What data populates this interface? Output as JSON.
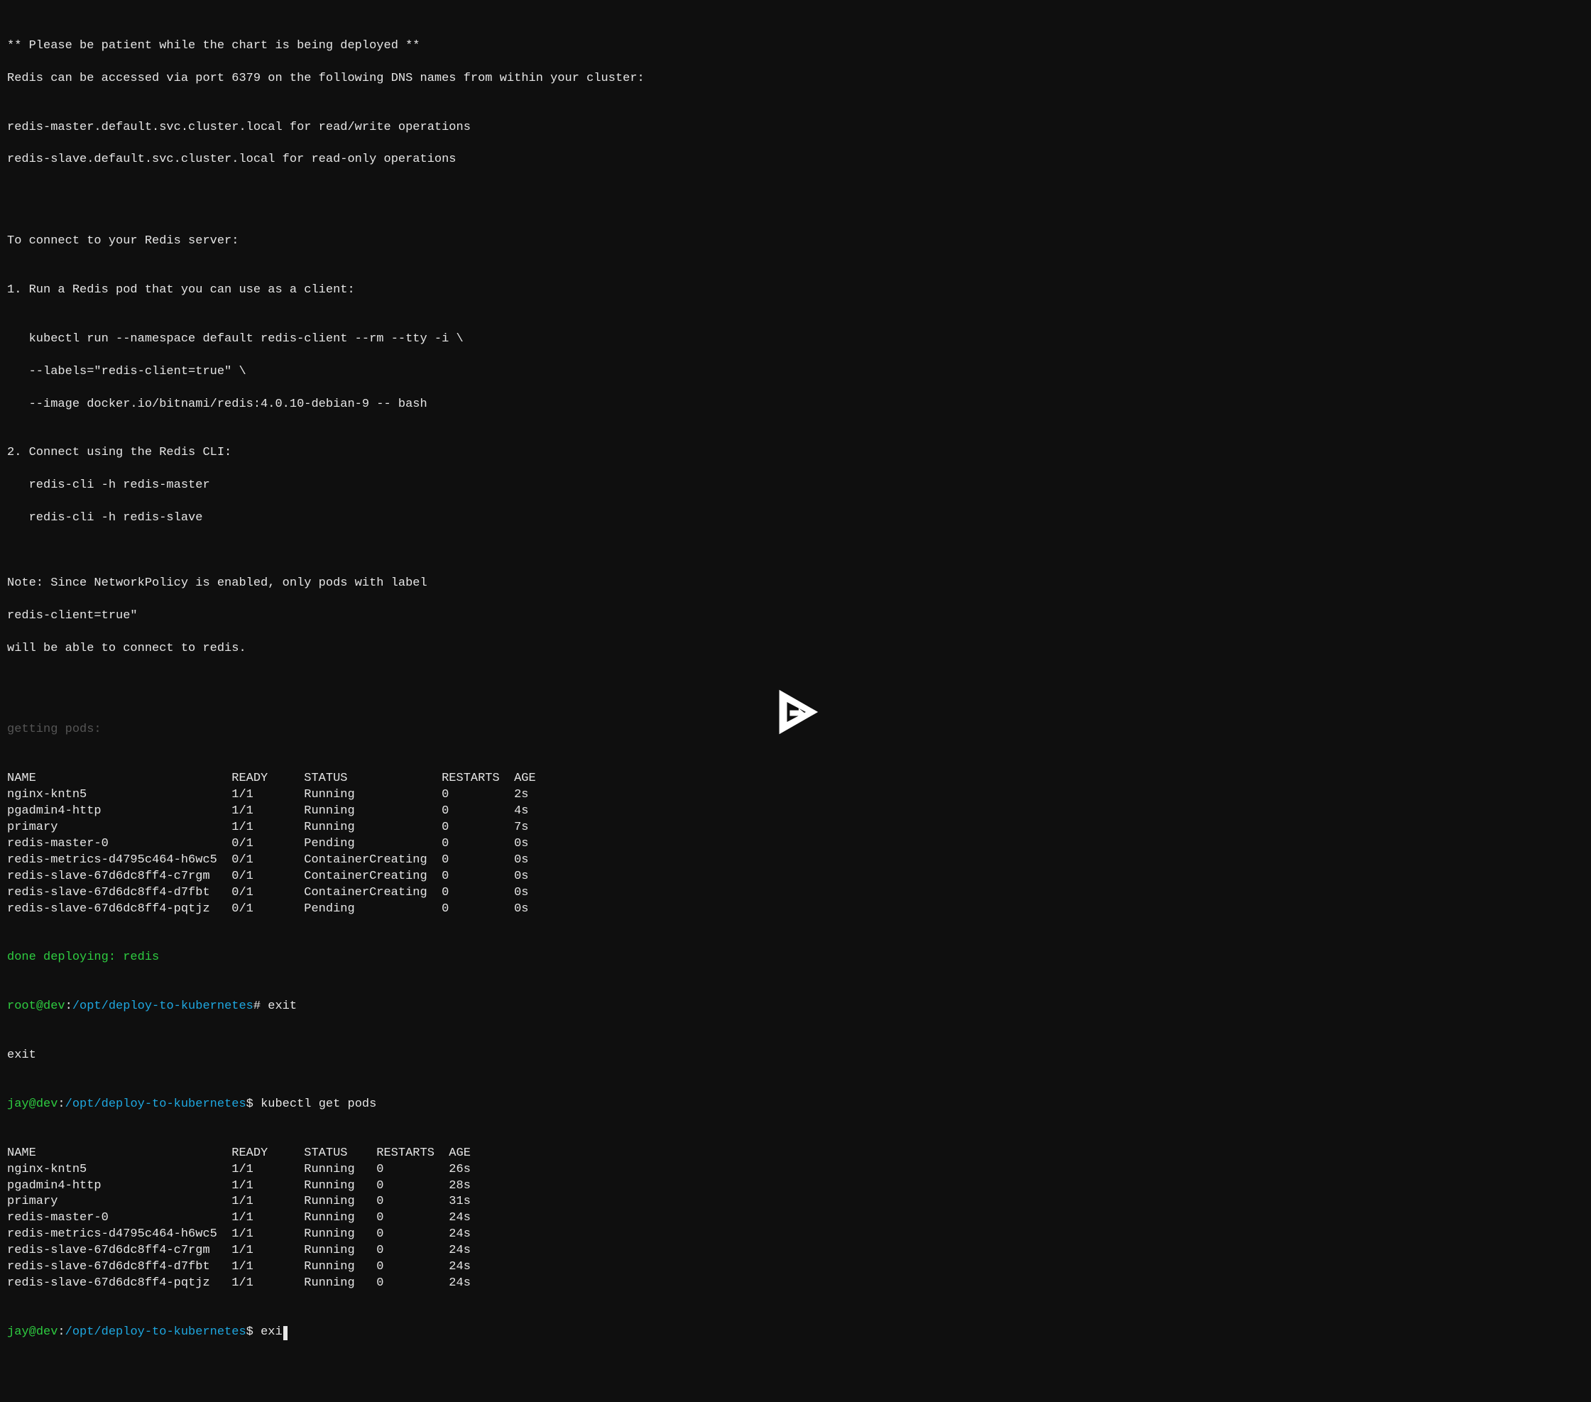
{
  "intro": {
    "l1": "** Please be patient while the chart is being deployed **",
    "l2": "Redis can be accessed via port 6379 on the following DNS names from within your cluster:",
    "blank1": "",
    "l3": "redis-master.default.svc.cluster.local for read/write operations",
    "l4": "redis-slave.default.svc.cluster.local for read-only operations",
    "blank2": "",
    "blank3": "",
    "blank4": "",
    "l5": "To connect to your Redis server:",
    "blank5": "",
    "l6": "1. Run a Redis pod that you can use as a client:",
    "blank6": "",
    "l7": "   kubectl run --namespace default redis-client --rm --tty -i \\",
    "l8": "   --labels=\"redis-client=true\" \\",
    "l9": "   --image docker.io/bitnami/redis:4.0.10-debian-9 -- bash",
    "blank7": "",
    "l10": "2. Connect using the Redis CLI:",
    "l11": "   redis-cli -h redis-master",
    "l12": "   redis-cli -h redis-slave",
    "blank8": "",
    "blank9": "",
    "l13": "Note: Since NetworkPolicy is enabled, only pods with label",
    "l14": "redis-client=true\"",
    "l15": "will be able to connect to redis.",
    "blank10": "",
    "blank11": ""
  },
  "getting_pods_label": "getting pods:",
  "pods1": {
    "headers": {
      "name": "NAME",
      "ready": "READY",
      "status": "STATUS",
      "restarts": "RESTARTS",
      "age": "AGE"
    },
    "rows": [
      {
        "name": "nginx-kntn5",
        "ready": "1/1",
        "status": "Running",
        "restarts": "0",
        "age": "2s"
      },
      {
        "name": "pgadmin4-http",
        "ready": "1/1",
        "status": "Running",
        "restarts": "0",
        "age": "4s"
      },
      {
        "name": "primary",
        "ready": "1/1",
        "status": "Running",
        "restarts": "0",
        "age": "7s"
      },
      {
        "name": "redis-master-0",
        "ready": "0/1",
        "status": "Pending",
        "restarts": "0",
        "age": "0s"
      },
      {
        "name": "redis-metrics-d4795c464-h6wc5",
        "ready": "0/1",
        "status": "ContainerCreating",
        "restarts": "0",
        "age": "0s"
      },
      {
        "name": "redis-slave-67d6dc8ff4-c7rgm",
        "ready": "0/1",
        "status": "ContainerCreating",
        "restarts": "0",
        "age": "0s"
      },
      {
        "name": "redis-slave-67d6dc8ff4-d7fbt",
        "ready": "0/1",
        "status": "ContainerCreating",
        "restarts": "0",
        "age": "0s"
      },
      {
        "name": "redis-slave-67d6dc8ff4-pqtjz",
        "ready": "0/1",
        "status": "Pending",
        "restarts": "0",
        "age": "0s"
      }
    ]
  },
  "done_deploying": "done deploying: redis",
  "prompt_root": {
    "user": "root",
    "at": "@",
    "host": "dev",
    "colon": ":",
    "path": "/opt/deploy-to-kubernetes",
    "sigil": "# ",
    "cmd": "exit"
  },
  "exit_echo": "exit",
  "prompt_jay1": {
    "user": "jay",
    "at": "@",
    "host": "dev",
    "colon": ":",
    "path": "/opt/deploy-to-kubernetes",
    "sigil": "$ ",
    "cmd": "kubectl get pods"
  },
  "pods2": {
    "headers": {
      "name": "NAME",
      "ready": "READY",
      "status": "STATUS",
      "restarts": "RESTARTS",
      "age": "AGE"
    },
    "rows": [
      {
        "name": "nginx-kntn5",
        "ready": "1/1",
        "status": "Running",
        "restarts": "0",
        "age": "26s"
      },
      {
        "name": "pgadmin4-http",
        "ready": "1/1",
        "status": "Running",
        "restarts": "0",
        "age": "28s"
      },
      {
        "name": "primary",
        "ready": "1/1",
        "status": "Running",
        "restarts": "0",
        "age": "31s"
      },
      {
        "name": "redis-master-0",
        "ready": "1/1",
        "status": "Running",
        "restarts": "0",
        "age": "24s"
      },
      {
        "name": "redis-metrics-d4795c464-h6wc5",
        "ready": "1/1",
        "status": "Running",
        "restarts": "0",
        "age": "24s"
      },
      {
        "name": "redis-slave-67d6dc8ff4-c7rgm",
        "ready": "1/1",
        "status": "Running",
        "restarts": "0",
        "age": "24s"
      },
      {
        "name": "redis-slave-67d6dc8ff4-d7fbt",
        "ready": "1/1",
        "status": "Running",
        "restarts": "0",
        "age": "24s"
      },
      {
        "name": "redis-slave-67d6dc8ff4-pqtjz",
        "ready": "1/1",
        "status": "Running",
        "restarts": "0",
        "age": "24s"
      }
    ]
  },
  "prompt_jay2": {
    "user": "jay",
    "at": "@",
    "host": "dev",
    "colon": ":",
    "path": "/opt/deploy-to-kubernetes",
    "sigil": "$ ",
    "cmd": "exi"
  }
}
